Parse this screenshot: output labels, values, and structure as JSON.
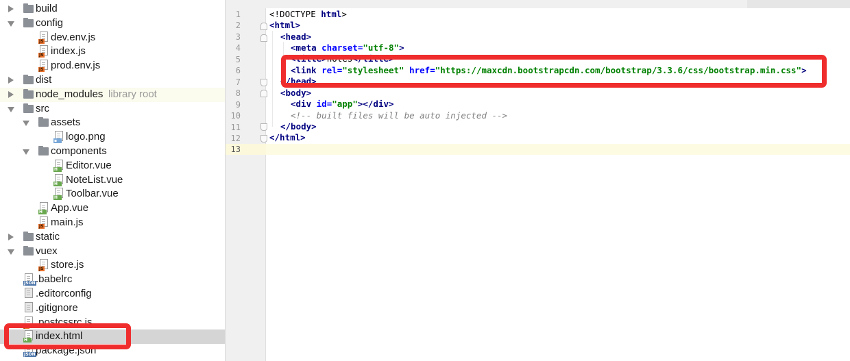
{
  "tree": {
    "items": [
      {
        "label": "build",
        "kind": "folder",
        "expanded": false
      },
      {
        "label": "config",
        "kind": "folder",
        "expanded": true
      },
      {
        "label": "dev.env.js",
        "kind": "js"
      },
      {
        "label": "index.js",
        "kind": "js"
      },
      {
        "label": "prod.env.js",
        "kind": "js"
      },
      {
        "label": "dist",
        "kind": "folder",
        "expanded": false
      },
      {
        "label": "node_modules",
        "kind": "folder",
        "expanded": false,
        "suffix": "library root"
      },
      {
        "label": "src",
        "kind": "folder",
        "expanded": true
      },
      {
        "label": "assets",
        "kind": "folder",
        "expanded": true
      },
      {
        "label": "logo.png",
        "kind": "png"
      },
      {
        "label": "components",
        "kind": "folder",
        "expanded": true
      },
      {
        "label": "Editor.vue",
        "kind": "vue"
      },
      {
        "label": "NoteList.vue",
        "kind": "vue"
      },
      {
        "label": "Toolbar.vue",
        "kind": "vue"
      },
      {
        "label": "App.vue",
        "kind": "vue"
      },
      {
        "label": "main.js",
        "kind": "js"
      },
      {
        "label": "static",
        "kind": "folder",
        "expanded": false
      },
      {
        "label": "vuex",
        "kind": "folder",
        "expanded": true
      },
      {
        "label": "store.js",
        "kind": "js"
      },
      {
        "label": ".babelrc",
        "kind": "json"
      },
      {
        "label": ".editorconfig",
        "kind": "text"
      },
      {
        "label": ".gitignore",
        "kind": "text"
      },
      {
        "label": ".postcssrc.js",
        "kind": "js"
      },
      {
        "label": "index.html",
        "kind": "vue",
        "selected": true
      },
      {
        "label": "package.json",
        "kind": "json"
      }
    ],
    "icon_tags": {
      "js": "JS",
      "vue": "H",
      "json": "JSON",
      "png": "▪"
    }
  },
  "editor": {
    "line_numbers": [
      "1",
      "2",
      "3",
      "4",
      "5",
      "6",
      "7",
      "8",
      "9",
      "10",
      "11",
      "12",
      "13"
    ],
    "lines": {
      "l1_doctype": "<!DOCTYPE ",
      "l1_html": "html",
      "l1_end": ">",
      "l2_tag": "<html>",
      "l3_tag": "<head>",
      "l4_open": "<meta ",
      "l4_attr": "charset=",
      "l4_val": "\"utf-8\"",
      "l4_close": ">",
      "l5_open": "<title>",
      "l5_text": "notes",
      "l5_close": "</title>",
      "l6_open": "<link ",
      "l6_rel": "rel=",
      "l6_relval": "\"stylesheet\" ",
      "l6_href": "href=",
      "l6_hrefval": "\"https://maxcdn.bootstrapcdn.com/bootstrap/3.3.6/css/bootstrap.min.css\"",
      "l6_close": ">",
      "l7_tag": "</head>",
      "l8_tag": "<body>",
      "l9_open": "<div ",
      "l9_id": "id=",
      "l9_val": "\"app\"",
      "l9_close": "></div>",
      "l10_comment": "<!-- built files will be auto injected -->",
      "l11_tag": "</body>",
      "l12_tag": "</html>"
    }
  },
  "colors": {
    "tag": "#000080",
    "attr": "#0000ff",
    "string": "#008000",
    "comment": "#808080",
    "highlight_box": "#f02d2d"
  }
}
